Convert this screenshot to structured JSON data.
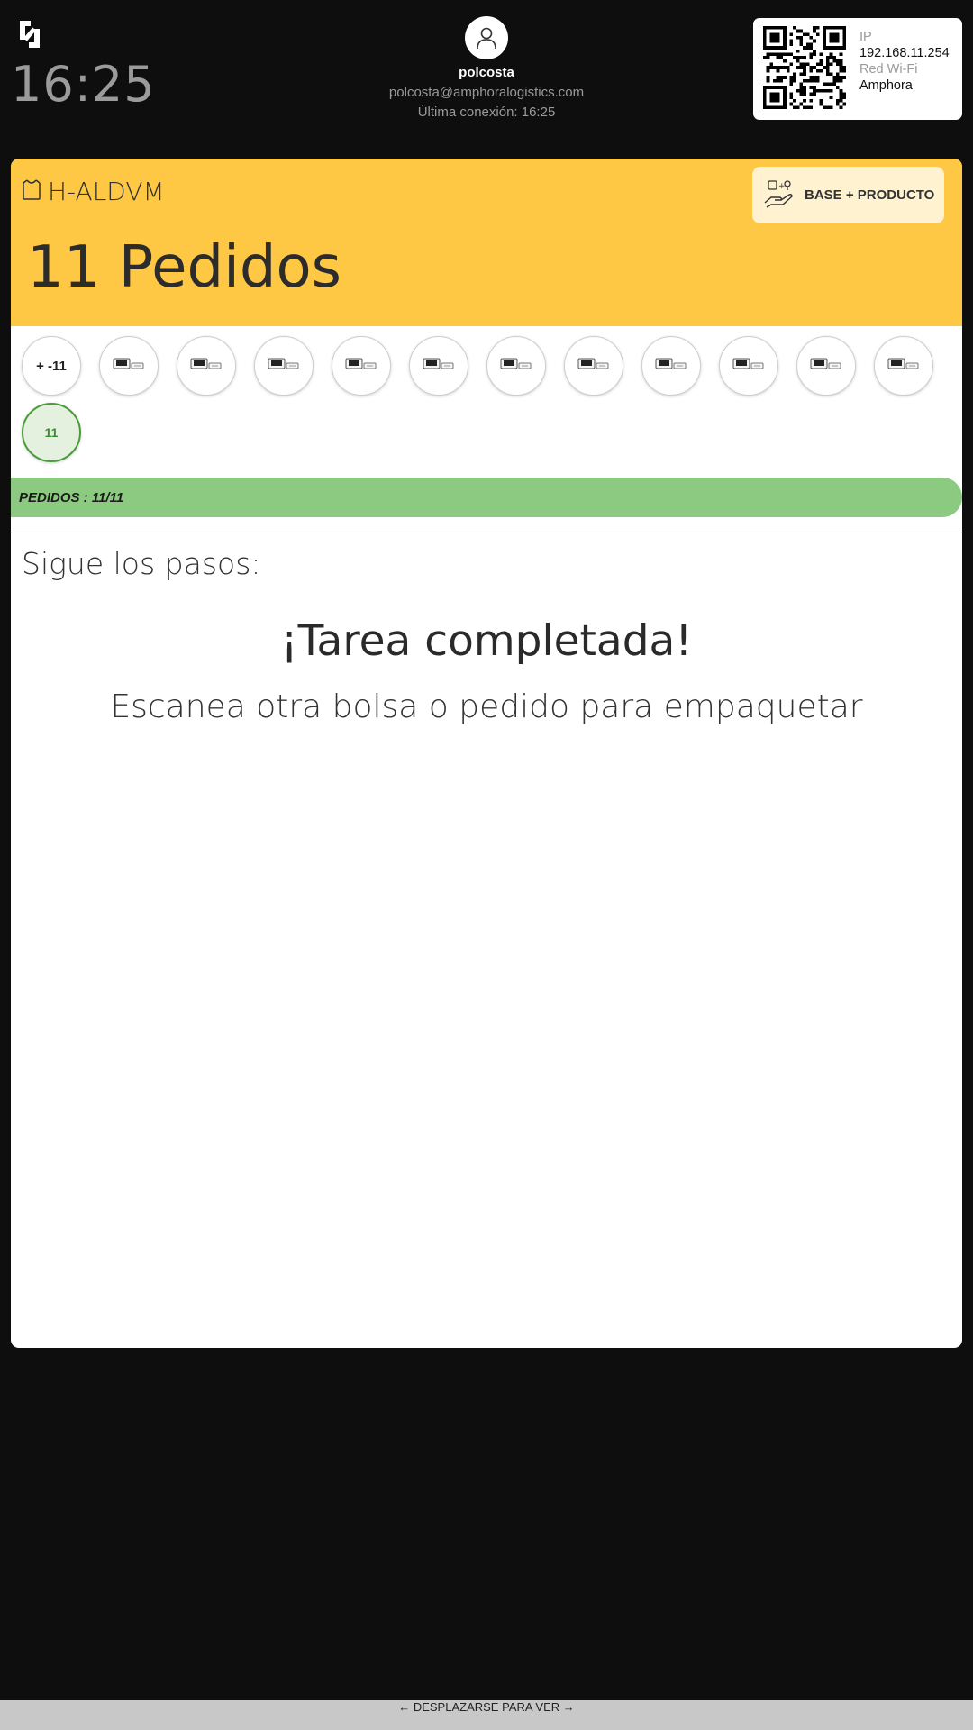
{
  "header": {
    "logo_icon": "amphora-logo",
    "time": "16:25",
    "user": {
      "avatar_icon": "user-icon",
      "name": "polcosta",
      "email": "polcosta@amphoralogistics.com",
      "last_connection": "Última conexión: 16:25"
    },
    "network": {
      "qr_icon": "qr-code-icon",
      "ip_label": "IP",
      "ip_value": "192.168.11.254",
      "wifi_label": "Red Wi-Fi",
      "wifi_value": "Amphora"
    }
  },
  "panel": {
    "bag_icon": "bag-icon",
    "bag_code": "H-ALDVM",
    "orders_title": "11 Pedidos",
    "base_button": {
      "icon": "hand-products-icon",
      "label": "BASE + PRODUCTO"
    },
    "order_circles": {
      "first_label": "+ -11",
      "product_icon": "product-image-icon",
      "product_count": 11,
      "done_label": "11"
    },
    "progress": {
      "label": "PEDIDOS : 11/11",
      "fraction": 1.0,
      "color": "#8cc981"
    },
    "steps_title": "Sigue los pasos:",
    "completed_title": "¡Tarea completada!",
    "completed_subtitle": "Escanea otra bolsa o pedido para empaquetar"
  },
  "footer": {
    "label": "← DESPLAZARSE PARA VER →"
  },
  "colors": {
    "accent": "#fec844",
    "background": "#0e0e0e",
    "success": "#4c9a3c"
  }
}
